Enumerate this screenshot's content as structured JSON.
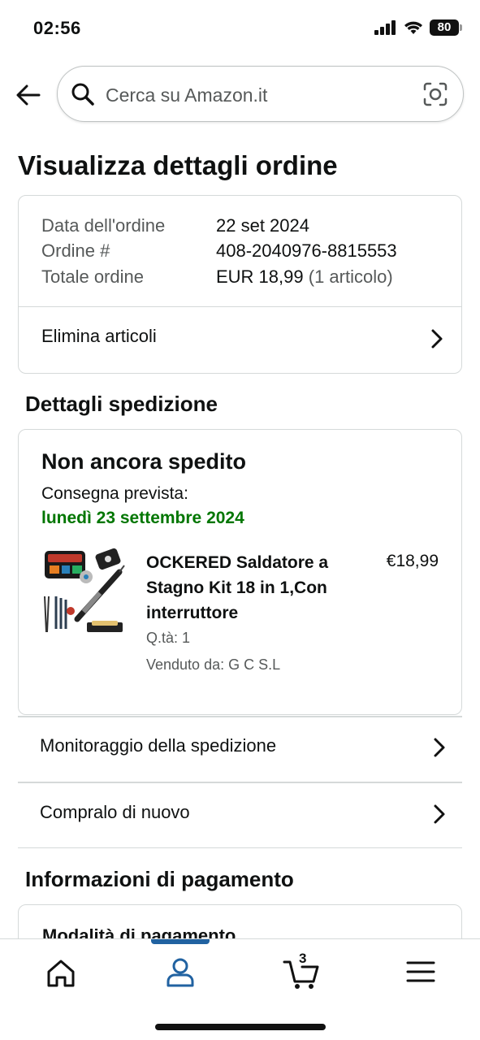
{
  "status_bar": {
    "time": "02:56",
    "battery": "80"
  },
  "search": {
    "placeholder": "Cerca su Amazon.it"
  },
  "page": {
    "title": "Visualizza dettagli ordine"
  },
  "order_summary": {
    "date_label": "Data dell'ordine",
    "date_value": "22 set 2024",
    "number_label": "Ordine #",
    "number_value": "408-2040976-8815553",
    "total_label": "Totale ordine",
    "total_value": "EUR 18,99",
    "total_items": "(1 articolo)",
    "delete_items_label": "Elimina articoli"
  },
  "shipping": {
    "section_title": "Dettagli spedizione",
    "status": "Non ancora spedito",
    "expected_label": "Consegna prevista:",
    "expected_date": "lunedì 23 settembre 2024",
    "product": {
      "title": "OCKERED Saldatore a Stagno Kit 18 in 1,Con interruttore",
      "price": "€18,99",
      "qty": "Q.tà: 1",
      "seller": "Venduto da: G C S.L"
    },
    "track_label": "Monitoraggio della spedizione",
    "buy_again_label": "Compralo di nuovo"
  },
  "payment": {
    "section_title": "Informazioni di pagamento",
    "method_label": "Modalità di pagamento"
  },
  "bottom_nav": {
    "cart_count": "3",
    "items": [
      "home-icon",
      "account-icon",
      "cart-icon",
      "menu-icon"
    ],
    "active": "account-icon"
  },
  "colors": {
    "accent": "#2162a1",
    "delivery_green": "#007600",
    "text": "#0f1111",
    "muted": "#565959"
  }
}
